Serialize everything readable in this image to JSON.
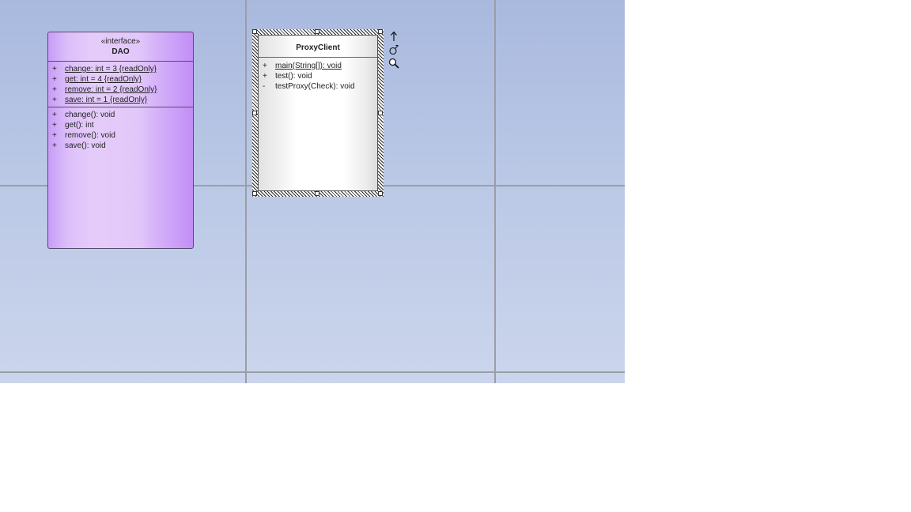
{
  "diagram": {
    "classes": {
      "dao": {
        "stereotype": "«interface»",
        "name": "DAO",
        "attributes": [
          {
            "visibility": "+",
            "text": "change: int = 3 {readOnly}"
          },
          {
            "visibility": "+",
            "text": "get: int = 4 {readOnly}"
          },
          {
            "visibility": "+",
            "text": "remove: int = 2 {readOnly}"
          },
          {
            "visibility": "+",
            "text": "save: int = 1 {readOnly}"
          }
        ],
        "operations": [
          {
            "visibility": "+",
            "text": "change(): void"
          },
          {
            "visibility": "+",
            "text": "get(): int"
          },
          {
            "visibility": "+",
            "text": "remove(): void"
          },
          {
            "visibility": "+",
            "text": "save(): void"
          }
        ]
      },
      "proxy_client": {
        "name": "ProxyClient",
        "operations": [
          {
            "visibility": "+",
            "text": "main(String[]): void"
          },
          {
            "visibility": "+",
            "text": "test(): void"
          },
          {
            "visibility": "-",
            "text": "testProxy(Check): void"
          }
        ]
      }
    },
    "quick_tools": [
      "arrow-up-icon",
      "link-hook-icon",
      "magnifier-icon"
    ],
    "colors": {
      "interface_fill": "#dcbef9",
      "interface_edge": "#c28ef6",
      "canvas_top": "#a9b9de",
      "canvas_bottom": "#cbd5ec",
      "grid_line": "#9a9ea6"
    }
  }
}
